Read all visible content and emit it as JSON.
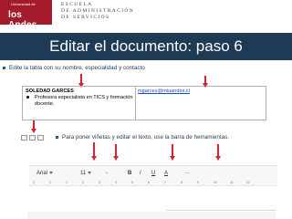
{
  "header": {
    "logo_small": "Universidad de",
    "logo_main": "los Andes",
    "school_line1": "ESCUELA",
    "school_line2": "DE ADMINISTRACIÓN",
    "school_line3": "DE SERVICIOS"
  },
  "slide": {
    "title": "Editar el documento: paso 6",
    "instruction": "Edite la tabla con su nombre, especialidad  y contacto",
    "hint": "Para poner viñetas y editar el texto, use la barra de herramientas."
  },
  "doc_table": {
    "name": "SOLEDAD GARCES",
    "specialty": "Profesora especialista en TICS y formación docente.",
    "email": "mgarces@miuandes.cl"
  },
  "toolbar": {
    "font": "Arial",
    "size": "11",
    "minus": "-",
    "bold": "B",
    "italic": "I",
    "underline": "U",
    "color": "A",
    "more": "···"
  },
  "ruler": [
    "2",
    "1",
    "1",
    "2",
    "3",
    "4",
    "5",
    "6",
    "7",
    "8",
    "9",
    "10",
    "11",
    "12"
  ],
  "colors": {
    "brand_red": "#a31b2b",
    "title_bar": "#1f3a55",
    "arrow": "#d2242f"
  }
}
